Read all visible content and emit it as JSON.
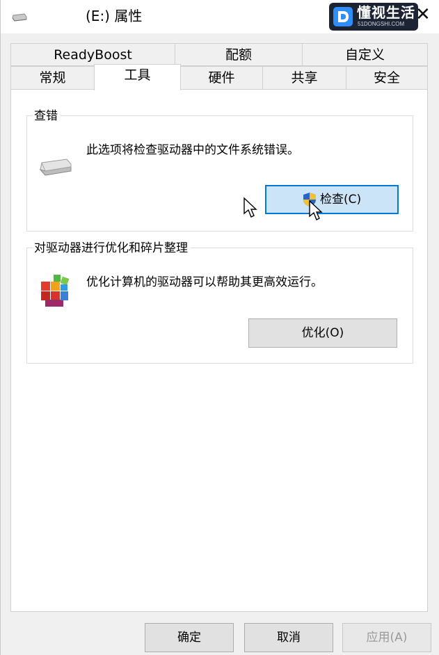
{
  "window": {
    "title": "(E:) 属性",
    "watermark": {
      "main": "懂视生活",
      "sub": "51DONGSHI.COM"
    }
  },
  "tabs": {
    "row1": [
      "ReadyBoost",
      "配额",
      "自定义"
    ],
    "row2": [
      "常规",
      "工具",
      "硬件",
      "共享",
      "安全"
    ],
    "active": "工具"
  },
  "check_group": {
    "title": "查错",
    "description": "此选项将检查驱动器中的文件系统错误。",
    "button_label": "检查(C)"
  },
  "optimize_group": {
    "title": "对驱动器进行优化和碎片整理",
    "description": "优化计算机的驱动器可以帮助其更高效运行。",
    "button_label": "优化(O)"
  },
  "footer": {
    "ok_label": "确定",
    "cancel_label": "取消",
    "apply_label": "应用(A)"
  },
  "icons": {
    "title": "drive-icon",
    "check": "hard-drive-icon",
    "shield": "uac-shield-icon",
    "optimize": "defrag-icon",
    "close": "close-icon"
  }
}
